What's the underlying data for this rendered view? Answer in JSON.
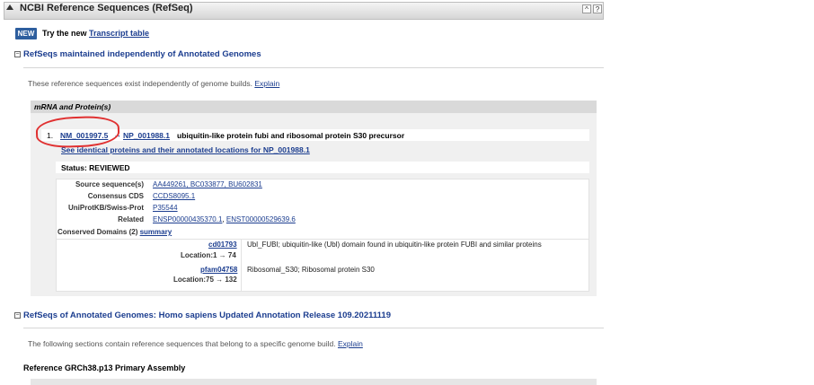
{
  "header": {
    "title": "NCBI Reference Sequences (RefSeq)",
    "btn_up": "^",
    "btn_help": "?"
  },
  "banner": {
    "badge": "NEW",
    "text": "Try the new",
    "link": "Transcript table"
  },
  "section1": {
    "toggle": "−",
    "title": "RefSeqs maintained independently of Annotated Genomes",
    "desc": "These reference sequences exist independently of genome builds.",
    "explain": "Explain",
    "group_header": "mRNA and Protein(s)",
    "entry": {
      "num": "1.",
      "mrna": "NM_001997.5",
      "arrow": "→",
      "protein": "NP_001988.1",
      "description": "ubiquitin-like protein fubi and ribosomal protein S30 precursor",
      "identical_link": "See identical proteins and their annotated locations for NP_001988.1",
      "status": "Status: REVIEWED",
      "source_label": "Source sequence(s)",
      "source_value": "AA449261, BC033877, BU602831",
      "ccds_label": "Consensus CDS",
      "ccds_value": "CCDS8095.1",
      "uniprot_label": "UniProtKB/Swiss-Prot",
      "uniprot_value": "P35544",
      "related_label": "Related",
      "related_value1": "ENSP00000435370.1",
      "related_sep": ",",
      "related_value2": "ENST00000529639.6",
      "domains_label": "Conserved Domains (2)",
      "domains_summary": "summary",
      "domains": [
        {
          "id": "cd01793",
          "location": "Location:1 → 74",
          "desc": "Ubl_FUBI; ubiquitin-like (Ubl) domain found in ubiquitin-like protein FUBI and similar proteins"
        },
        {
          "id": "pfam04758",
          "location": "Location:75 → 132",
          "desc": "Ribosomal_S30; Ribosomal protein S30"
        }
      ]
    }
  },
  "section2": {
    "toggle": "−",
    "title": "RefSeqs of Annotated Genomes: Homo sapiens Updated Annotation Release 109.20211119",
    "desc": "The following sections contain reference sequences that belong to a specific genome build.",
    "explain": "Explain",
    "assembly": "Reference GRCh38.p13 Primary Assembly"
  },
  "colors": {
    "link": "#1b3d8f",
    "badge": "#2d5e9e",
    "annotation_circle": "#e03030"
  }
}
